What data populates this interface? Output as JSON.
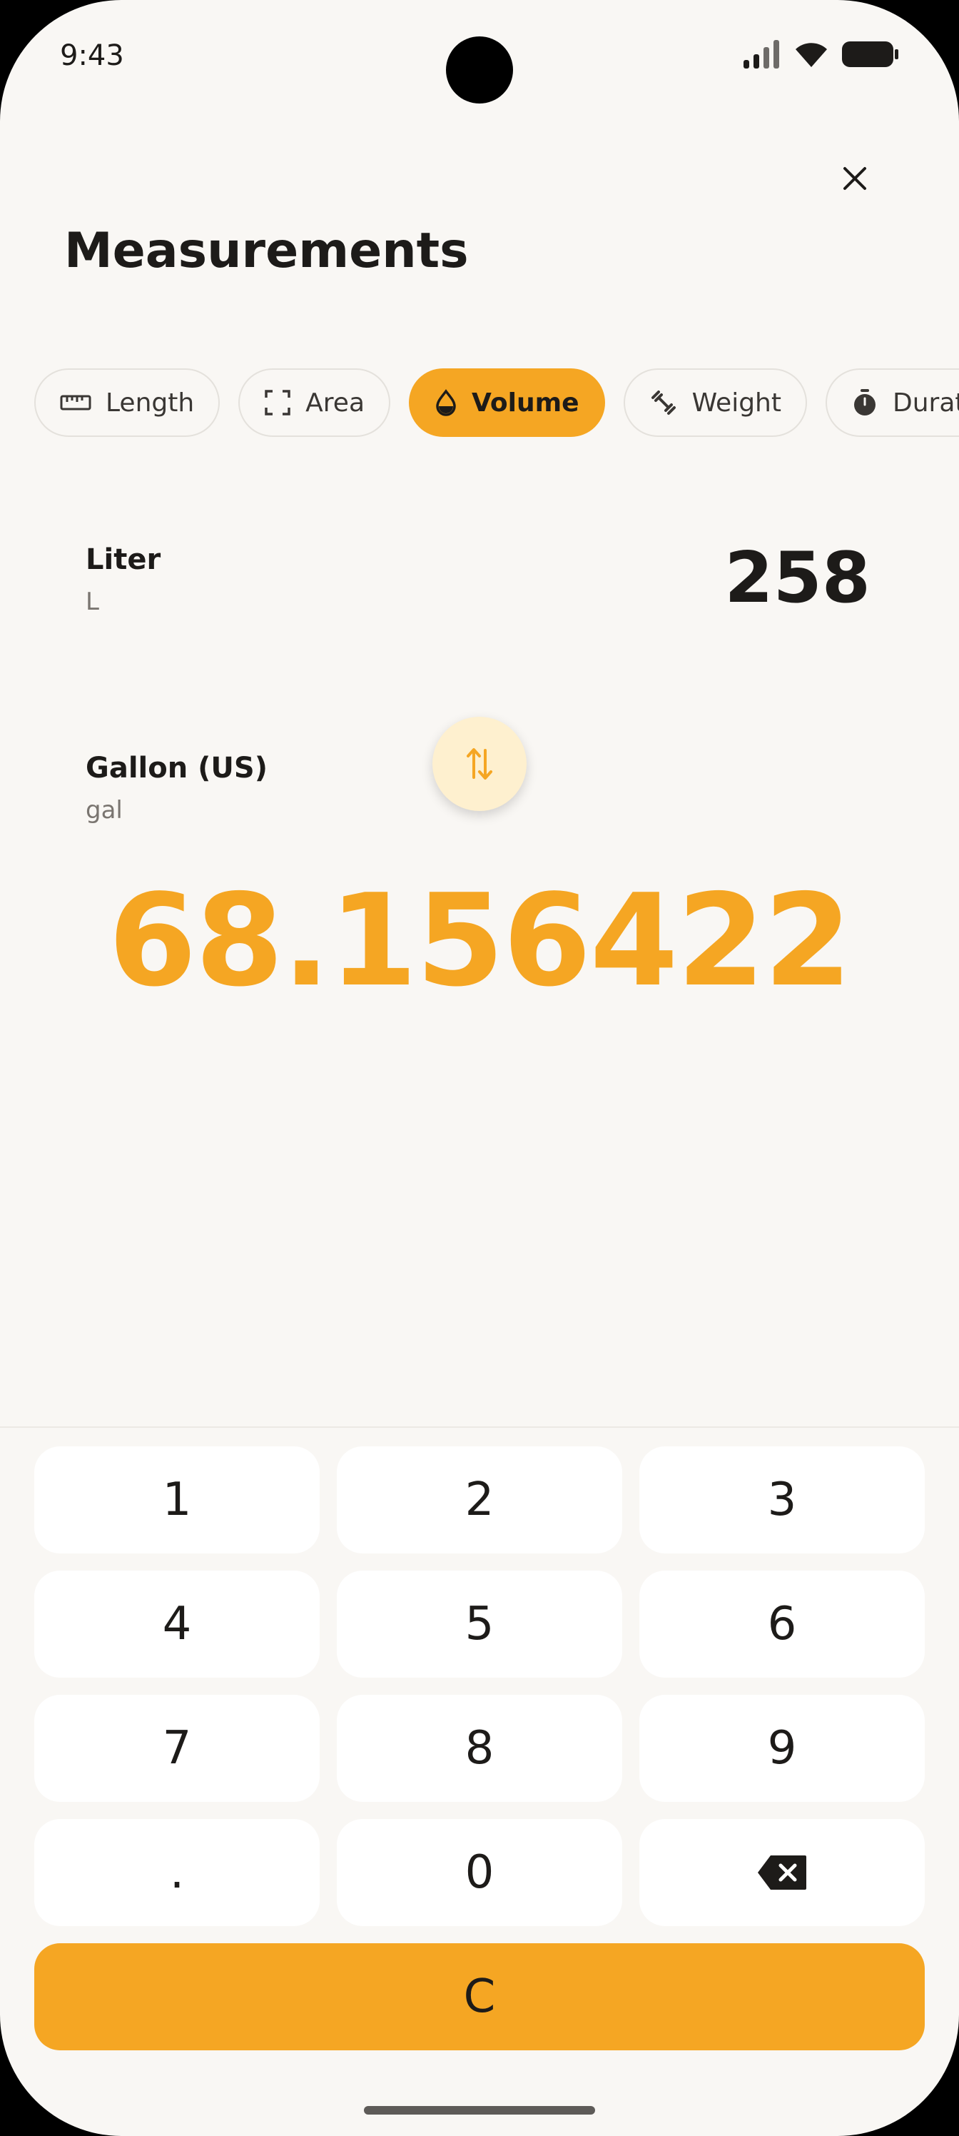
{
  "status_bar": {
    "time": "9:43"
  },
  "header": {
    "title": "Measurements"
  },
  "categories": [
    {
      "label": "Length",
      "icon": "ruler-icon",
      "active": false
    },
    {
      "label": "Area",
      "icon": "area-icon",
      "active": false
    },
    {
      "label": "Volume",
      "icon": "drop-icon",
      "active": true
    },
    {
      "label": "Weight",
      "icon": "dumbbell-icon",
      "active": false
    },
    {
      "label": "Duration",
      "icon": "stopwatch-icon",
      "active": false
    }
  ],
  "converter": {
    "from": {
      "name": "Liter",
      "abbr": "L",
      "value": "258"
    },
    "to": {
      "name": "Gallon (US)",
      "abbr": "gal"
    },
    "result": "68.156422"
  },
  "keypad": {
    "keys": [
      "1",
      "2",
      "3",
      "4",
      "5",
      "6",
      "7",
      "8",
      "9",
      ".",
      "0"
    ],
    "backspace_icon": "backspace-icon",
    "clear_label": "C"
  },
  "colors": {
    "accent": "#F5A623",
    "swap_bg": "#FEF0CF",
    "background": "#F9F7F4"
  }
}
